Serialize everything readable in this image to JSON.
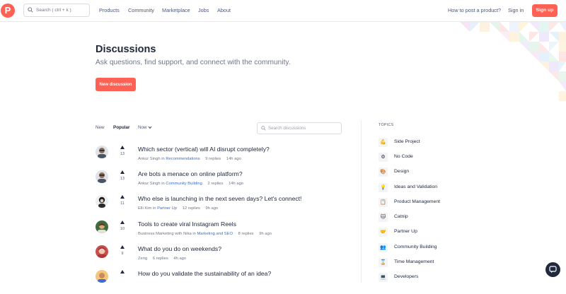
{
  "header": {
    "logo_letter": "P",
    "search_placeholder": "Search ( ctrl + k )",
    "nav": [
      "Products",
      "Community",
      "Marketplace",
      "Jobs",
      "About"
    ],
    "how_to_post": "How to post a product?",
    "sign_in": "Sign in",
    "sign_up": "Sign up"
  },
  "hero": {
    "title": "Discussions",
    "subtitle": "Ask questions, find support, and connect with the community.",
    "new_button": "New discussion"
  },
  "filters": {
    "new": "New",
    "popular": "Popular",
    "dropdown": "Now",
    "search_placeholder": "Search discussions"
  },
  "threads": [
    {
      "title": "Which sector (vertical) will AI disrupt completely?",
      "author": "Ankur Singh",
      "category": "Recommendations",
      "replies": "9 replies",
      "time": "14h ago",
      "votes": "13"
    },
    {
      "title": "Are bots a menace on online platform?",
      "author": "Ankur Singh",
      "category": "Community Building",
      "replies": "2 replies",
      "time": "14h ago",
      "votes": "13"
    },
    {
      "title": "Who else is launching in the next seven days? Let's connect!",
      "author": "Elli Kim",
      "category": "Partner Up",
      "replies": "12 replies",
      "time": "9h ago",
      "votes": "11"
    },
    {
      "title": "Tools to create viral Instagram Reels",
      "author": "Business Marketing with Nika",
      "category": "Marketing and SEO",
      "replies": "8 replies",
      "time": "9h ago",
      "votes": "10"
    },
    {
      "title": "What do you do on weekends?",
      "author": "Zeng",
      "category": "",
      "replies": "6 replies",
      "time": "4h ago",
      "votes": "9"
    },
    {
      "title": "How do you validate the sustainability of an idea?",
      "author": "",
      "category": "",
      "replies": "",
      "time": "",
      "votes": ""
    }
  ],
  "topics": {
    "heading": "TOPICS",
    "items": [
      {
        "label": "Side Project",
        "icon": "flexed-bicep-icon"
      },
      {
        "label": "No Code",
        "icon": "gear-icon"
      },
      {
        "label": "Design",
        "icon": "palette-icon"
      },
      {
        "label": "Ideas and Validation",
        "icon": "lightbulb-icon"
      },
      {
        "label": "Product Management",
        "icon": "clipboard-icon"
      },
      {
        "label": "Catnip",
        "icon": "cat-icon"
      },
      {
        "label": "Partner Up",
        "icon": "handshake-icon"
      },
      {
        "label": "Community Building",
        "icon": "people-icon"
      },
      {
        "label": "Time Management",
        "icon": "hourglass-icon"
      },
      {
        "label": "Developers",
        "icon": "developer-icon"
      }
    ]
  },
  "colors": {
    "accent": "#ff6154",
    "link": "#3b6fd1",
    "text": "#21293c",
    "muted": "#6f7785"
  }
}
